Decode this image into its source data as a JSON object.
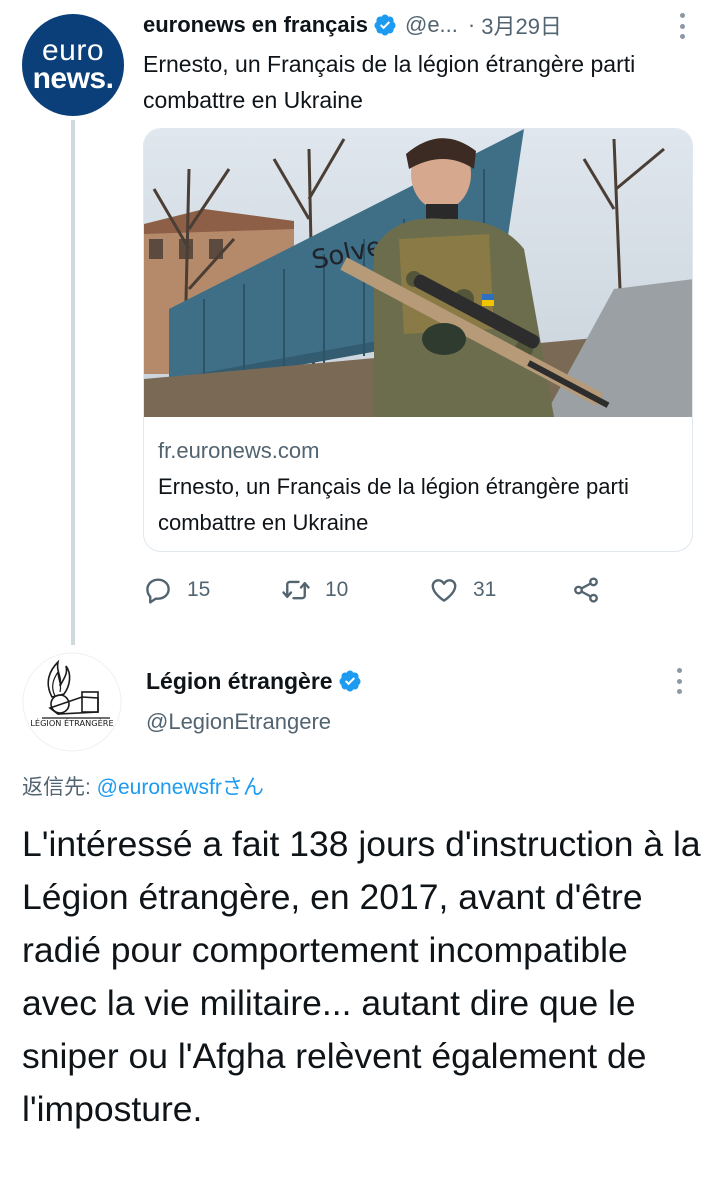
{
  "tweet1": {
    "avatar": {
      "line1": "euro",
      "line2": "news."
    },
    "display_name": "euronews en français",
    "handle": "@e...",
    "separator": "·",
    "date": "3月29日",
    "text": "Ernesto, un Français de la légion étrangère parti combattre en Ukraine",
    "card": {
      "domain": "fr.euronews.com",
      "title": "Ernesto, un Français de la légion étrangère parti combattre en Ukraine"
    },
    "actions": {
      "replies": "15",
      "retweets": "10",
      "likes": "31"
    }
  },
  "tweet2": {
    "avatar_caption": "LÉGION ÉTRANGÈRE",
    "display_name": "Légion étrangère",
    "handle": "@LegionEtrangere",
    "reply_prefix": "返信先: ",
    "reply_mention": "@euronewsfr",
    "reply_suffix": "さん",
    "text": "L'intéressé a fait 138 jours d'instruction à la Légion étrangère, en 2017, avant d'être radié pour comportement incompatible avec la vie militaire... autant dire que le sniper ou l'Afgha relèvent également de l'imposture."
  },
  "colors": {
    "verified": "#1d9bf0",
    "secondary_text": "#536471",
    "euronews_blue": "#0b3f79"
  }
}
